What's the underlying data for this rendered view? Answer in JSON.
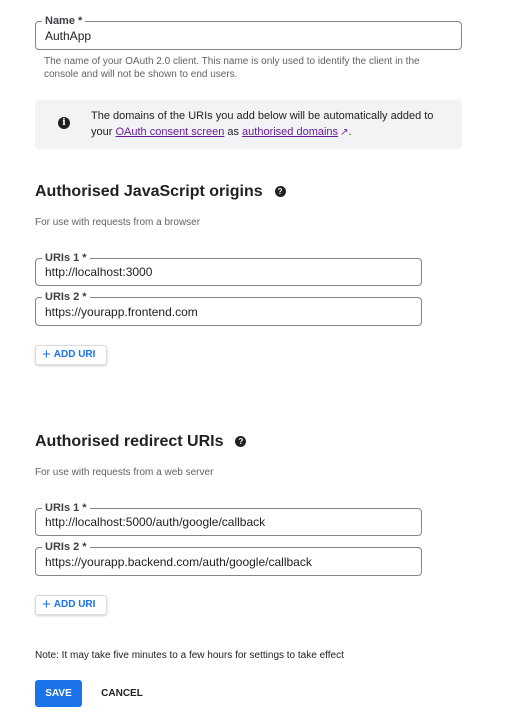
{
  "name_field": {
    "label": "Name *",
    "value": "AuthApp"
  },
  "name_helper": "The name of your OAuth 2.0 client. This name is only used to identify the client in the console and will not be shown to end users.",
  "info": {
    "line1": "The domains of the URIs you add below will be automatically added to",
    "prefix": "your ",
    "consent_link": "OAuth consent screen",
    "middle": " as ",
    "domains_link": "authorised domains",
    "suffix": "."
  },
  "js_origins": {
    "title": "Authorised JavaScript origins",
    "subtitle": "For use with requests from a browser",
    "uris": [
      {
        "label": "URIs 1 *",
        "value": "http://localhost:3000"
      },
      {
        "label": "URIs 2 *",
        "value": "https://yourapp.frontend.com"
      }
    ],
    "add_label": "ADD URI"
  },
  "redirect_uris": {
    "title": "Authorised redirect URIs",
    "subtitle": "For use with requests from a web server",
    "uris": [
      {
        "label": "URIs 1 *",
        "value": "http://localhost:5000/auth/google/callback"
      },
      {
        "label": "URIs 2 *",
        "value": "https://yourapp.backend.com/auth/google/callback"
      }
    ],
    "add_label": "ADD URI"
  },
  "note": "Note: It may take five minutes to a few hours for settings to take effect",
  "actions": {
    "save": "SAVE",
    "cancel": "CANCEL"
  },
  "icons": {
    "info": "info-icon",
    "help": "help-icon",
    "external": "open-in-new-icon",
    "add": "plus-icon"
  },
  "colors": {
    "primary": "#1a73e8",
    "link": "#6a1b9a",
    "info_bg": "#f1f3f4"
  }
}
